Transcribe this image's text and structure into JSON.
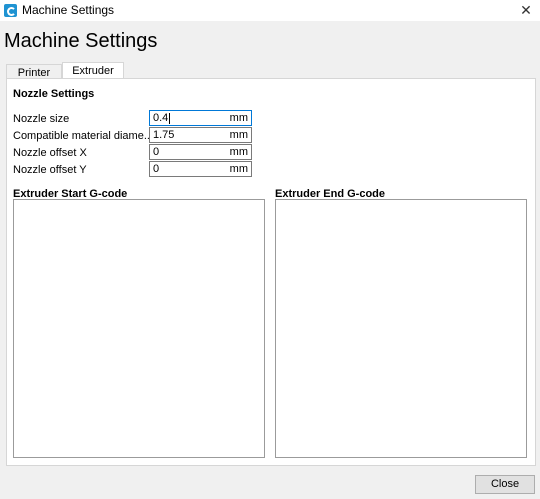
{
  "window": {
    "title": "Machine Settings",
    "close_glyph": "✕",
    "app_icon": "cura-logo-icon"
  },
  "header": {
    "title": "Machine Settings"
  },
  "tabs": [
    {
      "label": "Printer",
      "selected": false
    },
    {
      "label": "Extruder",
      "selected": true
    }
  ],
  "nozzle": {
    "section_title": "Nozzle Settings",
    "fields": [
      {
        "label": "Nozzle size",
        "value": "0.4",
        "unit": "mm"
      },
      {
        "label": "Compatible material diame...",
        "value": "1.75",
        "unit": "mm"
      },
      {
        "label": "Nozzle offset X",
        "value": "0",
        "unit": "mm"
      },
      {
        "label": "Nozzle offset Y",
        "value": "0",
        "unit": "mm"
      }
    ]
  },
  "gcode": {
    "start_title": "Extruder Start G-code",
    "end_title": "Extruder End G-code",
    "start_value": "",
    "end_value": ""
  },
  "footer": {
    "close_label": "Close"
  },
  "colors": {
    "focus_border": "#0078d7",
    "app_icon": "#1f93d2"
  }
}
